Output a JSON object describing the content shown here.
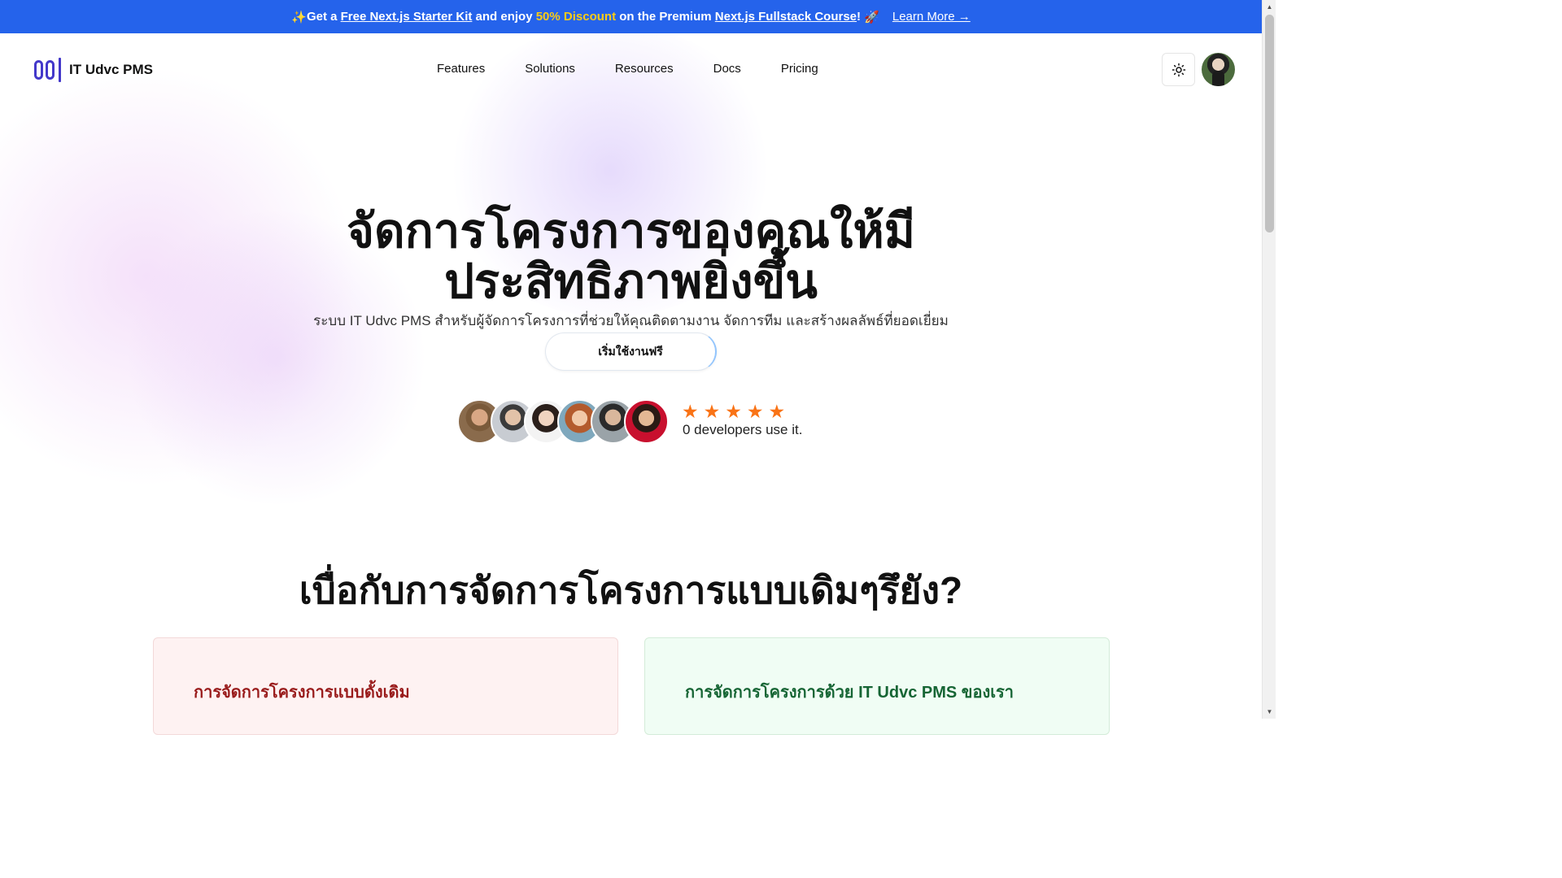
{
  "promo": {
    "emoji_start": "✨",
    "get_a": "Get a",
    "starter_kit": "Free Next.js Starter Kit",
    "and_enjoy": "and enjoy",
    "discount": "50% Discount",
    "on_premium": "on the Premium",
    "course": "Next.js Fullstack Course",
    "bang": "!",
    "emoji_end": "🚀",
    "learn_more": "Learn More →"
  },
  "brand": {
    "name": "IT Udvc PMS"
  },
  "nav": {
    "items": [
      {
        "label": "Features"
      },
      {
        "label": "Solutions"
      },
      {
        "label": "Resources"
      },
      {
        "label": "Docs"
      },
      {
        "label": "Pricing"
      }
    ]
  },
  "hero": {
    "title_line1": "จัดการโครงการของคุณให้มี",
    "title_line2": "ประสิทธิภาพยิ่งขึ้น",
    "subtitle": "ระบบ IT Udvc PMS สำหรับผู้จัดการโครงการที่ช่วยให้คุณติดตามงาน จัดการทีม และสร้างผลลัพธ์ที่ยอดเยี่ยม",
    "cta_label": "เริ่มใช้งานฟรี",
    "rating": {
      "stars": 5,
      "max": 5
    },
    "developers_text": "0 developers use it."
  },
  "comparison": {
    "title": "เบื่อกับการจัดการโครงการแบบเดิมๆรึยัง?",
    "traditional_title": "การจัดการโครงการแบบดั้งเดิม",
    "ours_title": "การจัดการโครงการด้วย IT Udvc PMS ของเรา"
  },
  "colors": {
    "promo_bg": "#2563eb",
    "promo_accent": "#facc15",
    "brand": "#4338ca",
    "star": "#f97316",
    "traditional_text": "#991b1b",
    "ours_text": "#166534"
  }
}
